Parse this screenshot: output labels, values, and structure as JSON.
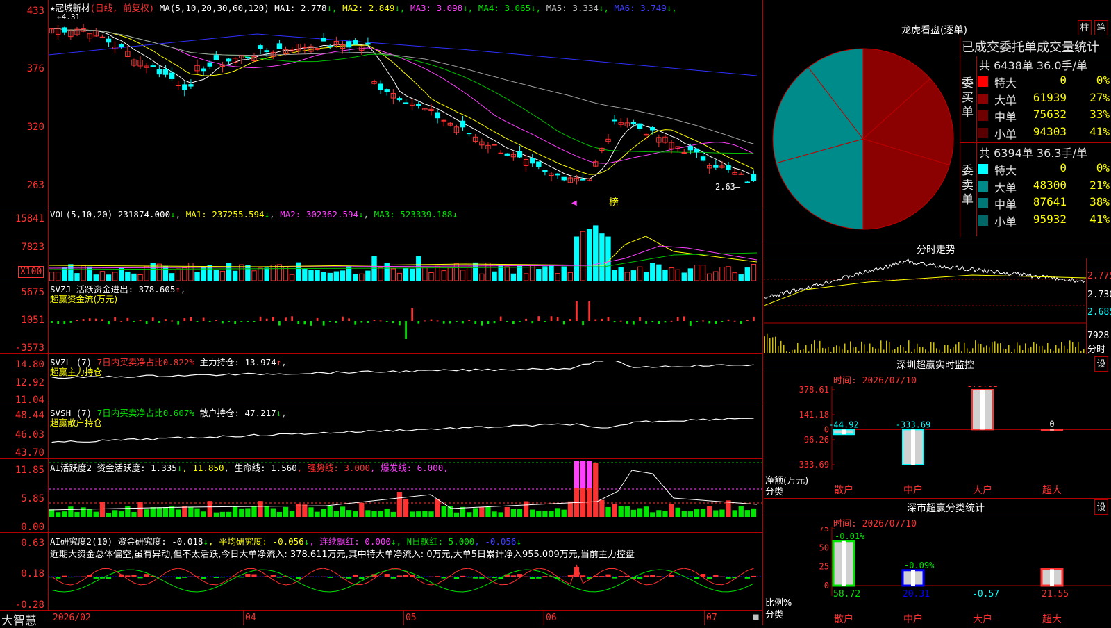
{
  "stock": {
    "name": "冠城新材",
    "period_label": "(日线, 前复权)",
    "ma_header": "MA(5,10,20,30,60,120)",
    "ma_values": [
      {
        "label": "MA1:",
        "value": "2.778",
        "color": "#ffffff"
      },
      {
        "label": "MA2:",
        "value": "2.849",
        "color": "#ffff00"
      },
      {
        "label": "MA3:",
        "value": "3.098",
        "color": "#ff40ff"
      },
      {
        "label": "MA4:",
        "value": "3.065",
        "color": "#00e600"
      },
      {
        "label": "MA5:",
        "value": "3.334",
        "color": "#c0c0c0"
      },
      {
        "label": "MA6:",
        "value": "3.749",
        "color": "#4040ff"
      }
    ],
    "high_marker": "4.31",
    "low_marker": "2.63",
    "bang_label": "榜"
  },
  "price_axis": [
    "433",
    "376",
    "320",
    "263"
  ],
  "vol": {
    "header": "VOL(5,10,20)",
    "value": "231874.000",
    "ma1": "MA1: 237255.594",
    "ma2": "MA2: 302362.594",
    "ma3": "MA3: 523339.188",
    "axis": [
      "15841",
      "7823",
      "X100"
    ]
  },
  "svzj": {
    "header": "SVZJ  活跃资金进出: 378.605",
    "subtitle": "超赢资金流(万元)",
    "axis": [
      "5675",
      "1051",
      "-3573"
    ]
  },
  "svzl": {
    "header_a": "SVZL (7) ",
    "header_b": "7日内买卖净占比0.822%",
    "header_c": " 主力持仓: 13.974",
    "subtitle": "超赢主力持仓",
    "axis": [
      "14.80",
      "12.92",
      "11.04"
    ]
  },
  "svsh": {
    "header_a": "SVSH (7) ",
    "header_b": "7日内买卖净占比0.607%",
    "header_c": " 散户持仓: 47.217",
    "subtitle": "超赢散户持仓",
    "axis": [
      "48.44",
      "46.03",
      "43.70"
    ]
  },
  "ai1": {
    "h1": "AI活跃度2 资金活跃度: 1.335",
    "h2": ", 11.850",
    "h3": ", 生命线: 1.560",
    "h4": ", 强势线: 3.000",
    "h5": ", 爆发线: 6.000,",
    "axis": [
      "11.85",
      "5.85",
      "0.00"
    ]
  },
  "ai2": {
    "h1": "AI研究度2(10) 资金研究度: -0.018",
    "h2": ", 平均研究度: -0.056",
    "h3": ", 连续飘红: 0.000",
    "h4": ", N日飘红: 5.000",
    "h5": ", -0.056",
    "comment": "近期大资金总体偏空,虽有异动,但不太活跃,今日大单净流入: 378.611万元,其中特大单净流入: 0万元,大单5日累计净入955.009万元,当前主力控盘",
    "axis": [
      "0.63",
      "0.18",
      "-0.28"
    ]
  },
  "date_axis": [
    "2026/02",
    "04",
    "05",
    "06",
    "07"
  ],
  "brand": "大智慧",
  "right": {
    "title": "龙虎看盘(逐单)",
    "btn1": "柱",
    "btn2": "笔",
    "stats_title": "已成交委托单成交量统计",
    "buy_label": "委买单",
    "sell_label": "委卖单",
    "buy_total": "共 6438单 36.0手/单",
    "sell_total": "共 6394单 36.3手/单",
    "buy_rows": [
      {
        "name": "特大",
        "value": "0",
        "pct": "0%",
        "color": "#ff0000"
      },
      {
        "name": "大单",
        "value": "61939",
        "pct": "27%",
        "color": "#8b0000"
      },
      {
        "name": "中单",
        "value": "75632",
        "pct": "33%",
        "color": "#6e0000"
      },
      {
        "name": "小单",
        "value": "94303",
        "pct": "41%",
        "color": "#5a0000"
      }
    ],
    "sell_rows": [
      {
        "name": "特大",
        "value": "0",
        "pct": "0%",
        "color": "#00ffff"
      },
      {
        "name": "大单",
        "value": "48300",
        "pct": "21%",
        "color": "#008b8b"
      },
      {
        "name": "中单",
        "value": "87641",
        "pct": "38%",
        "color": "#007777"
      },
      {
        "name": "小单",
        "value": "95932",
        "pct": "41%",
        "color": "#006666"
      }
    ],
    "intraday_title": "分时走势",
    "intraday_axis": [
      "2.775",
      "2.730",
      "2.685"
    ],
    "intraday_vol": "7928",
    "intraday_time": "分时",
    "sz_title": "深圳超赢实时监控",
    "sz_btn": "设",
    "sz_time": "时间: 2026/07/10",
    "sz_axis": [
      "378.61",
      "141.18",
      "0",
      "-96.26",
      "-333.69"
    ],
    "sz_ylabel": "净额(万元)",
    "sz_xlabel": "分类",
    "sz_bars": [
      {
        "cat": "散户",
        "value": -44.92,
        "label": "-44.92"
      },
      {
        "cat": "中户",
        "value": -333.69,
        "label": "-333.69"
      },
      {
        "cat": "大户",
        "value": 378.61,
        "label": "378.61"
      },
      {
        "cat": "超大",
        "value": 0,
        "label": "0"
      }
    ],
    "sc_title": "深市超赢分类统计",
    "sc_btn": "设",
    "sc_time": "时间: 2026/07/10",
    "sc_axis": [
      "75",
      "50",
      "25",
      "0"
    ],
    "sc_ylabel": "比例%",
    "sc_xlabel": "分类",
    "sc_bars": [
      {
        "cat": "散户",
        "value": 58.72,
        "label": "58.72",
        "top": "-0.01%"
      },
      {
        "cat": "中户",
        "value": 20.31,
        "label": "20.31",
        "top": "-0.09%"
      },
      {
        "cat": "大户",
        "value": -0.57,
        "label": "-0.57",
        "top": ""
      },
      {
        "cat": "超大",
        "value": 21.55,
        "label": "21.55",
        "top": ""
      }
    ]
  },
  "chart_data": [
    {
      "type": "pie",
      "title": "龙虎看盘(逐单)",
      "labels": [
        "买特大",
        "买大单",
        "买中单",
        "买小单",
        "卖特大",
        "卖大单",
        "卖中单",
        "卖小单"
      ],
      "values": [
        0,
        61939,
        75632,
        94303,
        0,
        48300,
        87641,
        95932
      ]
    },
    {
      "type": "bar",
      "title": "深圳超赢实时监控",
      "categories": [
        "散户",
        "中户",
        "大户",
        "超大"
      ],
      "values": [
        -44.92,
        -333.69,
        378.61,
        0
      ],
      "ylabel": "净额(万元)",
      "ylim": [
        -333.69,
        378.61
      ]
    },
    {
      "type": "bar",
      "title": "深市超赢分类统计",
      "categories": [
        "散户",
        "中户",
        "大户",
        "超大"
      ],
      "values": [
        58.72,
        20.31,
        -0.57,
        21.55
      ],
      "ylabel": "比例%",
      "ylim": [
        0,
        75
      ]
    }
  ]
}
